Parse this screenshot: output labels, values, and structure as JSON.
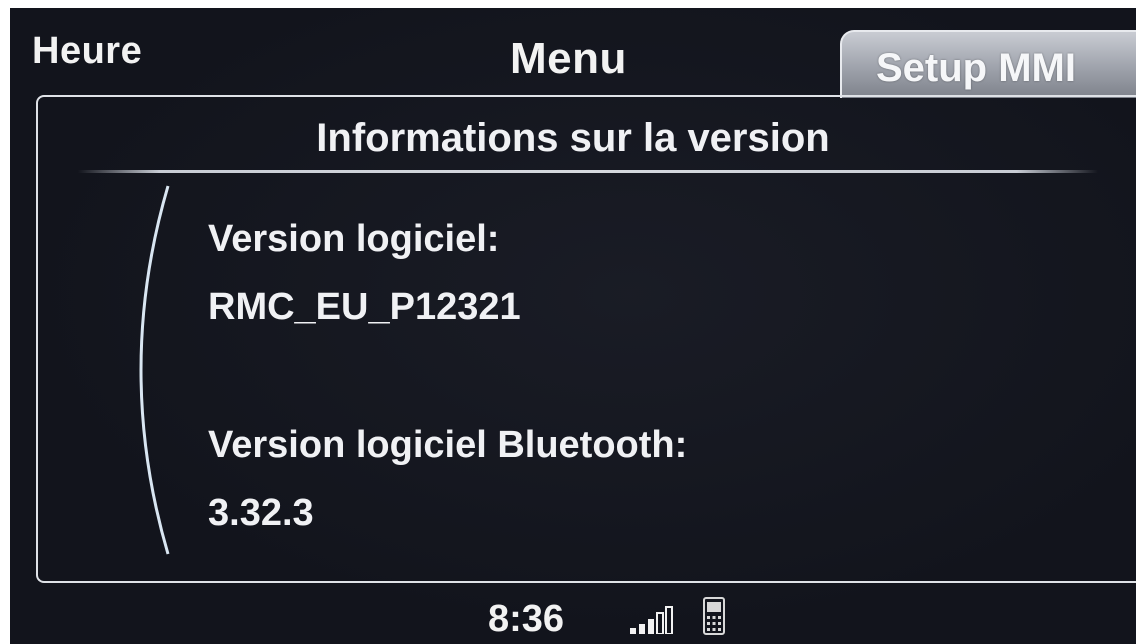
{
  "tabs": {
    "left_label": "Heure",
    "center_label": "Menu",
    "active_label": "Setup MMI"
  },
  "panel": {
    "title": "Informations sur la version",
    "software_version_label": "Version logiciel:",
    "software_version_value": "RMC_EU_P12321",
    "bluetooth_version_label": "Version logiciel Bluetooth:",
    "bluetooth_version_value": "3.32.3"
  },
  "status_bar": {
    "time": "8:36",
    "signal_icon": "signal-strength-icon",
    "signal_bars_filled": 3,
    "signal_bars_total": 5,
    "phone_icon": "mobile-phone-icon"
  },
  "colors": {
    "background": "#12141c",
    "text": "#eef0f4",
    "active_tab": "#a9adb5",
    "frame": "#dfe2e7"
  }
}
